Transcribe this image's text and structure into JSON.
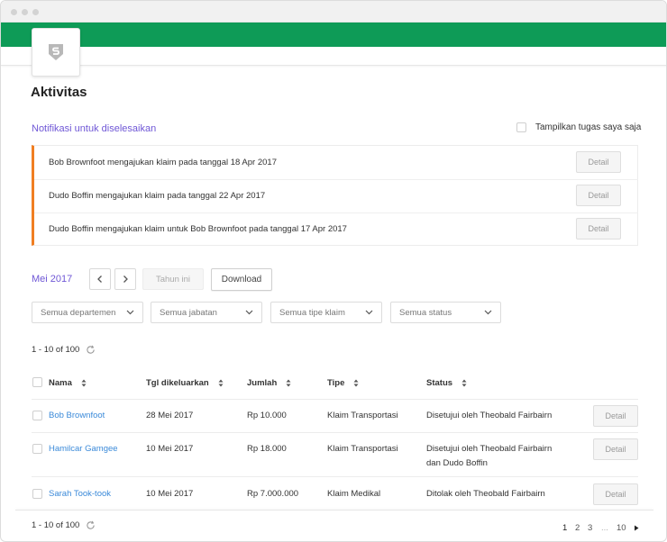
{
  "header": {
    "title": "Aktivitas"
  },
  "notifications": {
    "title": "Notifikasi untuk diselesaikan",
    "my_tasks_label": "Tampilkan tugas saya saja",
    "items": [
      {
        "text": "Bob Brownfoot  mengajukan klaim pada tanggal 18 Apr 2017",
        "button": "Detail"
      },
      {
        "text": "Dudo Boffin  mengajukan klaim pada tanggal 22 Apr 2017",
        "button": "Detail"
      },
      {
        "text": "Dudo Boffin mengajukan klaim untuk Bob Brownfoot pada tanggal 17 Apr 2017",
        "button": "Detail"
      }
    ]
  },
  "period": {
    "month": "Mei 2017",
    "year_button": "Tahun ini",
    "download_button": "Download"
  },
  "filters": [
    {
      "value": "Semua departemen"
    },
    {
      "value": "Semua jabatan"
    },
    {
      "value": "Semua tipe klaim"
    },
    {
      "value": "Semua status"
    }
  ],
  "count_top": "1 - 10 of 100",
  "count_bottom": "1 - 10 of 100",
  "table": {
    "columns": [
      "Nama",
      "Tgl dikeluarkan",
      "Jumlah",
      "Tipe",
      "Status"
    ],
    "rows": [
      {
        "name": "Bob Brownfoot",
        "date": "28 Mei 2017",
        "amount": "Rp 10.000",
        "type": "Klaim Transportasi",
        "status": "Disetujui oleh Theobald Fairbairn",
        "button": "Detail"
      },
      {
        "name": "Hamilcar Gamgee",
        "date": "10 Mei 2017",
        "amount": "Rp 18.000",
        "type": "Klaim Transportasi",
        "status": "Disetujui oleh Theobald Fairbairn dan Dudo Boffin",
        "button": "Detail"
      },
      {
        "name": "Sarah Took-took",
        "date": "10 Mei 2017",
        "amount": "Rp 7.000.000",
        "type": "Klaim Medikal",
        "status": "Ditolak oleh Theobald Fairbairn",
        "button": "Detail"
      }
    ]
  },
  "pagination": {
    "pages": [
      "1",
      "2",
      "3"
    ],
    "ellipsis": "...",
    "last": "10",
    "current": "1"
  },
  "colors": {
    "brand": "#0e9b57",
    "accent": "#6f57d6",
    "link": "#3b8ad9",
    "notice_border": "#f07e22"
  },
  "icons": {
    "logo": "shield-s-icon",
    "refresh": "refresh-icon",
    "prev": "chevron-left-icon",
    "next": "chevron-right-icon",
    "sort": "sort-icon",
    "dropdown": "chevron-down-icon",
    "page_next": "triangle-right-icon"
  }
}
